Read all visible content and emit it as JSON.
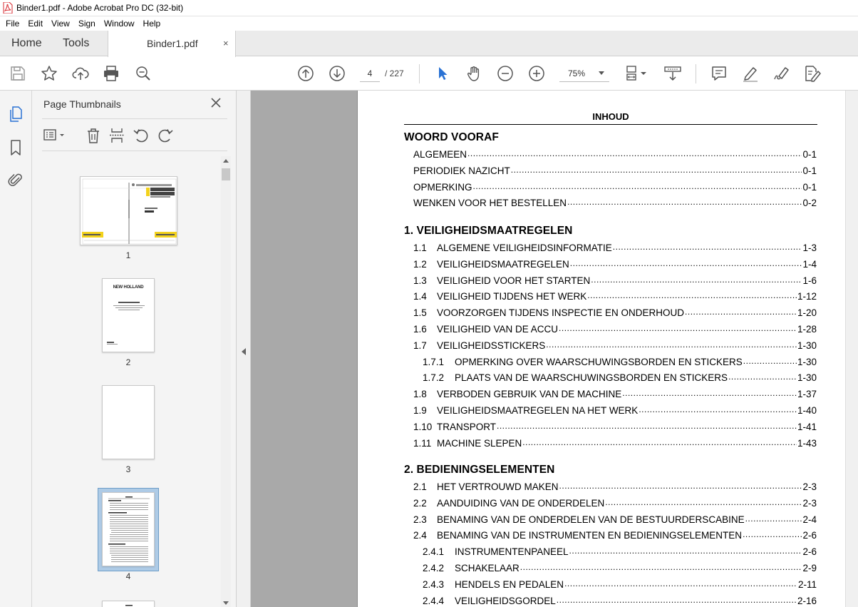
{
  "window": {
    "title": "Binder1.pdf - Adobe Acrobat Pro DC (32-bit)"
  },
  "menu": [
    "File",
    "Edit",
    "View",
    "Sign",
    "Window",
    "Help"
  ],
  "tabs": {
    "home": "Home",
    "tools": "Tools",
    "document": "Binder1.pdf",
    "close_glyph": "×"
  },
  "toolbar": {
    "current_page": "4",
    "total_pages": "/ 227",
    "zoom": "75%"
  },
  "thumbnail_panel": {
    "title": "Page Thumbnails",
    "pages": [
      "1",
      "2",
      "3",
      "4"
    ],
    "selected_page": "4"
  },
  "thumb_content": {
    "brand": "NEW HOLLAND",
    "model_a": "30.28R",
    "model_b": "35.28R"
  },
  "document": {
    "heading": "INHOUD",
    "sections": [
      {
        "title": "WOORD VOORAF",
        "entries": [
          {
            "num": "",
            "text": "ALGEMEEN",
            "page": "0-1"
          },
          {
            "num": "",
            "text": "PERIODIEK NAZICHT",
            "page": "0-1"
          },
          {
            "num": "",
            "text": "OPMERKING",
            "page": "0-1"
          },
          {
            "num": "",
            "text": "WENKEN VOOR HET BESTELLEN",
            "page": "0-2"
          }
        ]
      },
      {
        "title": "1. VEILIGHEIDSMAATREGELEN",
        "entries": [
          {
            "num": "1.1",
            "text": "ALGEMENE VEILIGHEIDSINFORMATIE",
            "page": "1-3"
          },
          {
            "num": "1.2",
            "text": "VEILIGHEIDSMAATREGELEN",
            "page": "1-4"
          },
          {
            "num": "1.3",
            "text": "VEILIGHEID VOOR HET STARTEN",
            "page": "1-6"
          },
          {
            "num": "1.4",
            "text": "VEILIGHEID TIJDENS HET WERK",
            "page": "1-12"
          },
          {
            "num": "1.5",
            "text": "VOORZORGEN TIJDENS INSPECTIE EN ONDERHOUD",
            "page": "1-20"
          },
          {
            "num": "1.6",
            "text": "VEILIGHEID VAN DE ACCU",
            "page": "1-28"
          },
          {
            "num": "1.7",
            "text": "VEILIGHEIDSSTICKERS",
            "page": "1-30"
          },
          {
            "num": "1.7.1",
            "text": "OPMERKING OVER WAARSCHUWINGSBORDEN EN STICKERS",
            "page": "1-30"
          },
          {
            "num": "1.7.2",
            "text": "PLAATS VAN DE WAARSCHUWINGSBORDEN EN STICKERS",
            "page": "1-30"
          },
          {
            "num": "1.8",
            "text": "VERBODEN GEBRUIK VAN DE MACHINE",
            "page": "1-37"
          },
          {
            "num": "1.9",
            "text": "VEILIGHEIDSMAATREGELEN NA HET WERK",
            "page": "1-40"
          },
          {
            "num": "1.10",
            "text": "TRANSPORT",
            "page": "1-41"
          },
          {
            "num": "1.11",
            "text": "MACHINE SLEPEN",
            "page": "1-43"
          }
        ]
      },
      {
        "title": "2. BEDIENINGSELEMENTEN",
        "entries": [
          {
            "num": "2.1",
            "text": "HET VERTROUWD MAKEN",
            "page": "2-3"
          },
          {
            "num": "2.2",
            "text": "AANDUIDING VAN DE ONDERDELEN",
            "page": "2-3"
          },
          {
            "num": "2.3",
            "text": "BENAMING VAN DE ONDERDELEN VAN DE BESTUURDERSCABINE",
            "page": "2-4"
          },
          {
            "num": "2.4",
            "text": "BENAMING VAN DE INSTRUMENTEN EN BEDIENINGSELEMENTEN",
            "page": "2-6"
          },
          {
            "num": "2.4.1",
            "text": "INSTRUMENTENPANEEL",
            "page": "2-6"
          },
          {
            "num": "2.4.2",
            "text": "SCHAKELAAR",
            "page": "2-9"
          },
          {
            "num": "2.4.3",
            "text": "HENDELS EN PEDALEN",
            "page": "2-11"
          },
          {
            "num": "2.4.4",
            "text": "VEILIGHEIDSGORDEL",
            "page": "2-16"
          }
        ]
      }
    ]
  },
  "colors": {
    "acrobat_red": "#d7282f",
    "toolbar_blue": "#2a72d4",
    "icon_gray": "#555555",
    "doc_background": "#a9a9a9",
    "thumb_selected": "#aecbe6",
    "nh_yellow": "#f3d21c"
  },
  "icons": {
    "toolbar": [
      "save-icon",
      "bookmark-star-icon",
      "upload-cloud-icon",
      "print-icon",
      "zoom-search-icon",
      "page-up-icon",
      "page-down-icon",
      "select-arrow-icon",
      "hand-icon",
      "zoom-out-icon",
      "zoom-in-icon",
      "fit-page-icon",
      "scroll-mode-icon",
      "comment-icon",
      "highlight-pen-icon",
      "sign-icon",
      "edit-pdf-icon"
    ],
    "rail": [
      "page-thumbnails-icon",
      "bookmarks-icon",
      "attachments-icon"
    ],
    "panel": [
      "options-menu-icon",
      "delete-icon",
      "split-icon",
      "rotate-ccw-icon",
      "rotate-cw-icon"
    ]
  }
}
